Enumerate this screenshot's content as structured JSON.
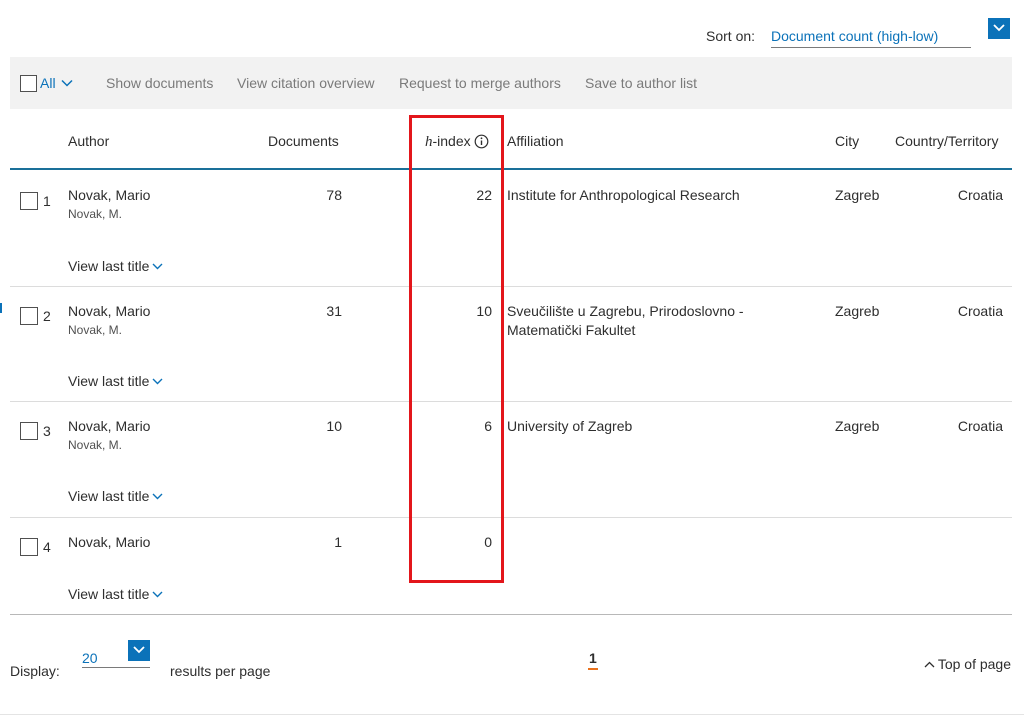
{
  "sort": {
    "label": "Sort on:",
    "value": "Document count (high-low)"
  },
  "toolbar": {
    "all_label": "All",
    "actions": [
      "Show documents",
      "View citation overview",
      "Request to merge authors",
      "Save to author list"
    ]
  },
  "table": {
    "headers": {
      "author": "Author",
      "documents": "Documents",
      "h_index_prefix": "h",
      "h_index_suffix": "-index",
      "affiliation": "Affiliation",
      "city": "City",
      "country": "Country/Territory"
    },
    "view_last_label": "View last title",
    "rows": [
      {
        "num": "1",
        "name": "Novak, Mario",
        "variant": "Novak, M.",
        "documents": "78",
        "h_index": "22",
        "affiliation": "Institute for Anthropological Research",
        "city": "Zagreb",
        "country": "Croatia"
      },
      {
        "num": "2",
        "name": "Novak, Mario",
        "variant": "Novak, M.",
        "documents": "31",
        "h_index": "10",
        "affiliation": "Sveučilište u Zagrebu, Prirodoslovno - Matematički Fakultet",
        "city": "Zagreb",
        "country": "Croatia"
      },
      {
        "num": "3",
        "name": "Novak, Mario",
        "variant": "Novak, M.",
        "documents": "10",
        "h_index": "6",
        "affiliation": "University of Zagreb",
        "city": "Zagreb",
        "country": "Croatia"
      },
      {
        "num": "4",
        "name": "Novak, Mario",
        "variant": "",
        "documents": "1",
        "h_index": "0",
        "affiliation": "",
        "city": "",
        "country": ""
      }
    ]
  },
  "footer": {
    "display_label": "Display:",
    "display_value": "20",
    "results_per_page": "results per page",
    "current_page": "1",
    "top_of_page": "Top of page"
  },
  "colors": {
    "link_blue": "#0b72b9",
    "header_rule": "#1a7099",
    "highlight_red": "#e3161b",
    "page_accent": "#e9711c"
  },
  "icons": {
    "select_caret": "chevron-down-icon",
    "info": "info-icon",
    "top_of_page": "chevron-up-icon"
  }
}
